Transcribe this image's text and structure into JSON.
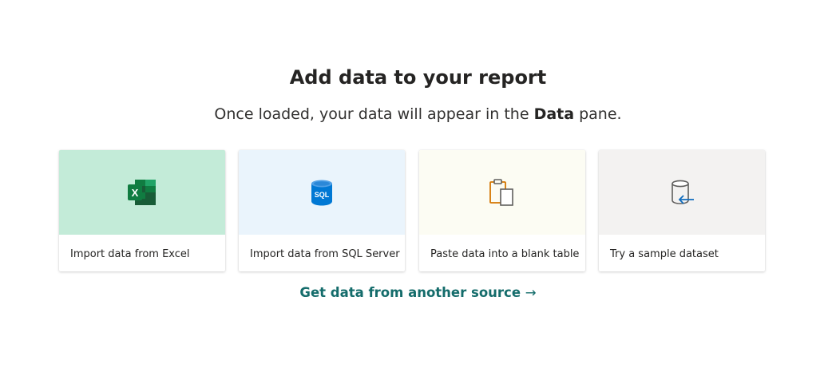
{
  "heading": "Add data to your report",
  "subheading": {
    "before": "Once loaded, your data will appear in the ",
    "bold": "Data",
    "after": " pane."
  },
  "cards": [
    {
      "label": "Import data from Excel",
      "icon": "excel-icon",
      "bg": "#c3ebd8"
    },
    {
      "label": "Import data from SQL Server",
      "icon": "sql-database-icon",
      "bg": "#eaf4fc"
    },
    {
      "label": "Paste data into a blank table",
      "icon": "clipboard-paste-icon",
      "bg": "#fcfcf3"
    },
    {
      "label": "Try a sample dataset",
      "icon": "sample-database-icon",
      "bg": "#f3f2f1"
    }
  ],
  "link": {
    "label": "Get data from another source",
    "arrow": "→"
  },
  "icon_text": {
    "excel_letter": "X",
    "sql": "SQL"
  },
  "colors": {
    "link": "#146c6b",
    "excel_green": "#107c41",
    "sql_blue": "#0078d4",
    "paste_orange": "#d47500"
  }
}
